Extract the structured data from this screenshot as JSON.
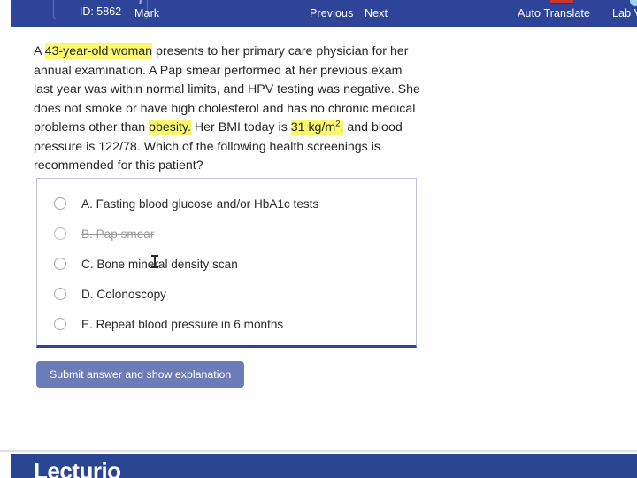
{
  "topbar": {
    "id_label": "ID: 5862",
    "mark_label": "Mark",
    "previous_label": "Previous",
    "next_label": "Next",
    "auto_translate_label": "Auto Translate",
    "lab_values_label": "Lab Val",
    "bg_color": "#2d4498",
    "icons": {
      "flag": "flag-icon",
      "beaker": "beaker-icon",
      "mark": "bookmark-icon",
      "previous": "arrow-left-icon",
      "next": "arrow-right-icon"
    }
  },
  "question": {
    "segments": [
      {
        "text": "A ",
        "highlight": false
      },
      {
        "text": "43-year-old woman",
        "highlight": true
      },
      {
        "text": " presents to her primary care physician for her annual examination. A Pap smear performed at her previous exam last year was within normal limits, and HPV testing was negative. She does not smoke or have high cholesterol and has no chronic medical problems other than ",
        "highlight": false
      },
      {
        "text": "obesity.",
        "highlight": true
      },
      {
        "text": " Her BMI today is ",
        "highlight": false
      },
      {
        "text": "31 kg/m2,",
        "highlight": true,
        "sup": "2"
      },
      {
        "text": " and blood pressure is 122/78. Which of the following health screenings is recommended for this patient?",
        "highlight": false
      }
    ],
    "full_text": "A 43-year-old woman presents to her primary care physician for her annual examination. A Pap smear performed at her previous exam last year was within normal limits, and HPV testing was negative. She does not smoke or have high cholesterol and has no chronic medical problems other than obesity. Her BMI today is 31 kg/m², and blood pressure is 122/78. Which of the following health screenings is recommended for this patient?",
    "highlight_color": "#fbf86e"
  },
  "answers": {
    "options": [
      {
        "label": "A. Fasting blood glucose and/or HbA1c tests",
        "struck": false,
        "selected": false
      },
      {
        "label": "B. Pap smear",
        "struck": true,
        "selected": false
      },
      {
        "label": "C. Bone mineral density scan",
        "struck": false,
        "selected": false
      },
      {
        "label": "D. Colonoscopy",
        "struck": false,
        "selected": false
      },
      {
        "label": "E. Repeat blood pressure in 6 months",
        "struck": false,
        "selected": false
      }
    ],
    "accent_color": "#2d4498"
  },
  "submit": {
    "label": "Submit answer and show explanation",
    "color": "#6b7cb8"
  },
  "footer": {
    "logo_text": "Lecturio",
    "bg_color": "#2a4591"
  }
}
